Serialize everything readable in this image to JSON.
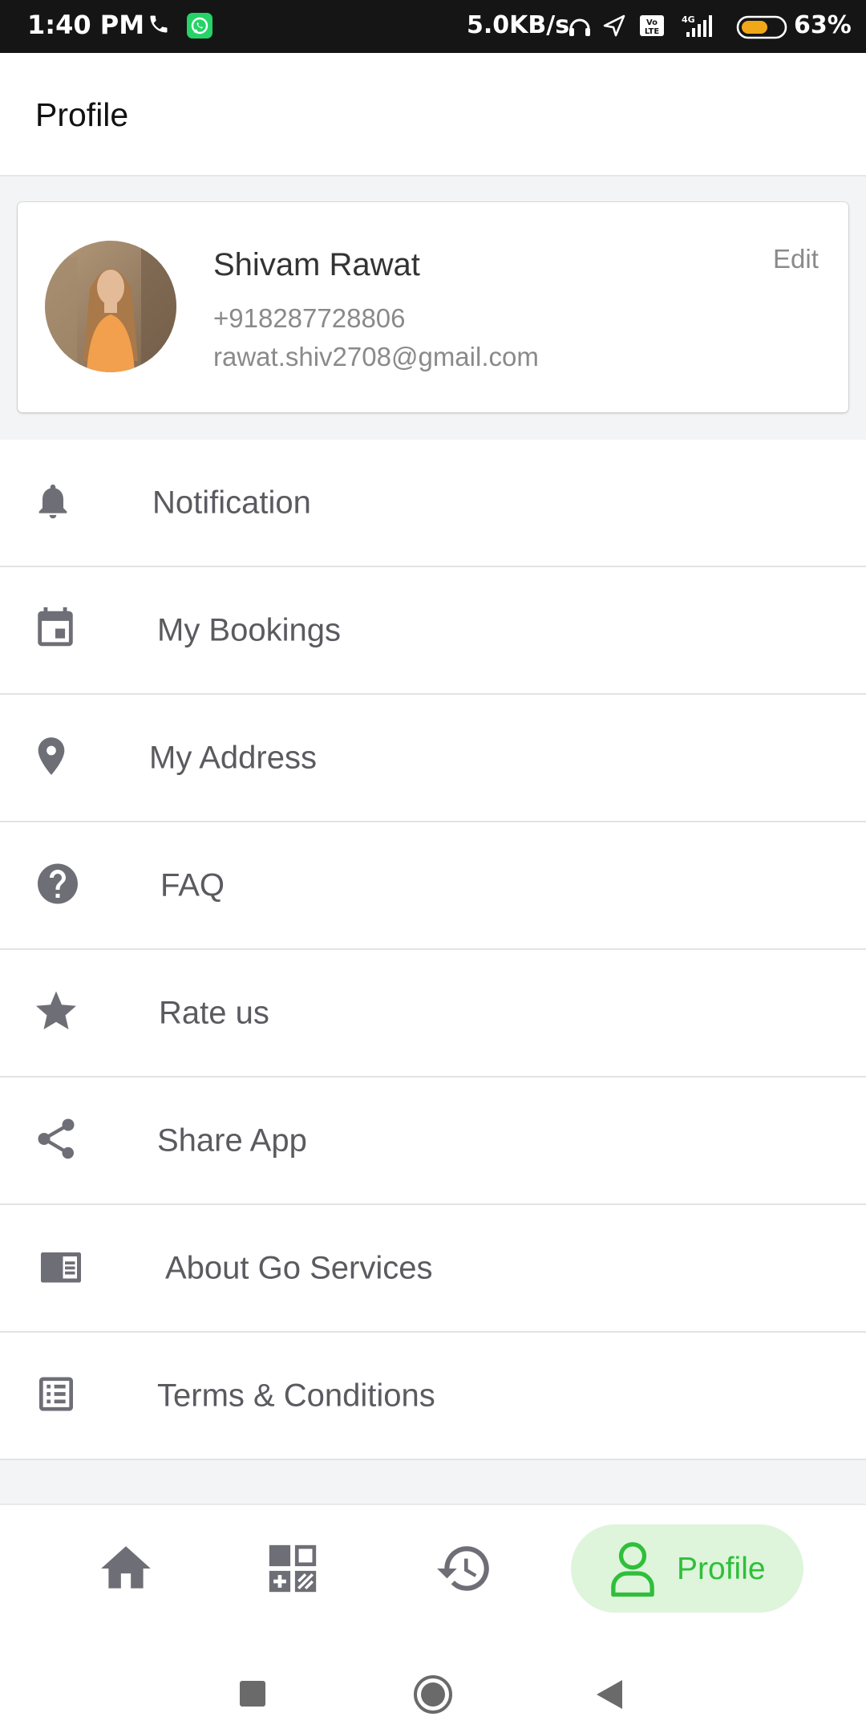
{
  "status_bar": {
    "time": "1:40 PM",
    "network_speed": "5.0KB/s",
    "battery_percent": "63%",
    "battery_level": 0.63
  },
  "app_bar": {
    "title": "Profile"
  },
  "profile": {
    "name": "Shivam Rawat",
    "phone": "+918287728806",
    "email": "rawat.shiv2708@gmail.com",
    "edit_label": "Edit"
  },
  "menu": {
    "items": [
      {
        "label": "Notification",
        "icon": "bell-icon"
      },
      {
        "label": "My Bookings",
        "icon": "calendar-icon"
      },
      {
        "label": "My Address",
        "icon": "location-pin-icon"
      },
      {
        "label": "FAQ",
        "icon": "help-circle-icon"
      },
      {
        "label": "Rate us",
        "icon": "star-icon"
      },
      {
        "label": "Share App",
        "icon": "share-icon"
      },
      {
        "label": "About Go Services",
        "icon": "book-icon"
      },
      {
        "label": "Terms & Conditions",
        "icon": "list-icon"
      }
    ]
  },
  "bottom_nav": {
    "items": [
      {
        "icon": "home-icon"
      },
      {
        "icon": "dashboard-grid-icon"
      },
      {
        "icon": "history-icon"
      },
      {
        "icon": "user-icon",
        "label": "Profile",
        "active": true
      }
    ],
    "active_color": "#2fbf3a",
    "active_bg": "#def5dc"
  },
  "colors": {
    "icon_gray": "#6e6e76",
    "text_gray": "#5a5a60"
  }
}
